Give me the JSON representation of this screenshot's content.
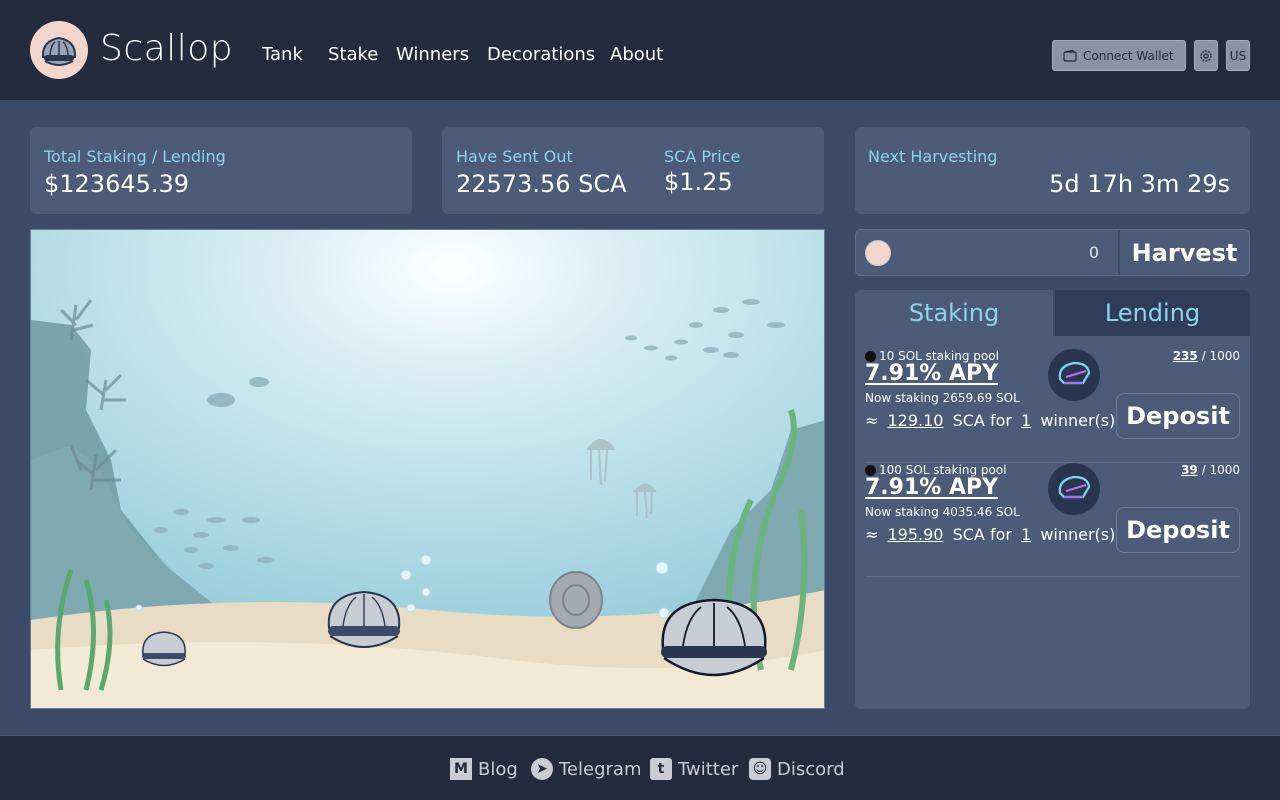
{
  "brand": {
    "name": "Scallop"
  },
  "nav": [
    "Tank",
    "Stake",
    "Winners",
    "Decorations",
    "About"
  ],
  "header": {
    "connect_label": "Connect Wallet",
    "lang": "US"
  },
  "stats": {
    "total_label": "Total Staking / Lending",
    "total_value": "$123645.39",
    "sent_label": "Have Sent Out",
    "sent_value": "22573.56 SCA",
    "price_label": "SCA Price",
    "price_value": "$1.25",
    "next_label": "Next Harvesting",
    "next_value": "5d 17h 3m 29s"
  },
  "harvest": {
    "amount": "0",
    "label": "Harvest"
  },
  "tabs": {
    "staking": "Staking",
    "lending": "Lending"
  },
  "pools": [
    {
      "title": "10 SOL staking pool",
      "apy": "7.91% APY",
      "now": "Now staking 2659.69 SOL",
      "approx": "≈",
      "sca": "129.10",
      "sca_for": "SCA for",
      "winners": "1",
      "winners_label": "winner(s)",
      "filled": "235",
      "capacity": "/ 1000",
      "deposit": "Deposit"
    },
    {
      "title": "100 SOL staking pool",
      "apy": "7.91% APY",
      "now": "Now staking 4035.46 SOL",
      "approx": "≈",
      "sca": "195.90",
      "sca_for": "SCA for",
      "winners": "1",
      "winners_label": "winner(s)",
      "filled": "39",
      "capacity": "/ 1000",
      "deposit": "Deposit"
    }
  ],
  "footer": {
    "blog": "Blog",
    "telegram": "Telegram",
    "twitter": "Twitter",
    "discord": "Discord"
  },
  "colors": {
    "header": "#222c3c",
    "bg": "#3b4b68",
    "card": "#4b5b78",
    "accent": "#8fd3ec"
  }
}
